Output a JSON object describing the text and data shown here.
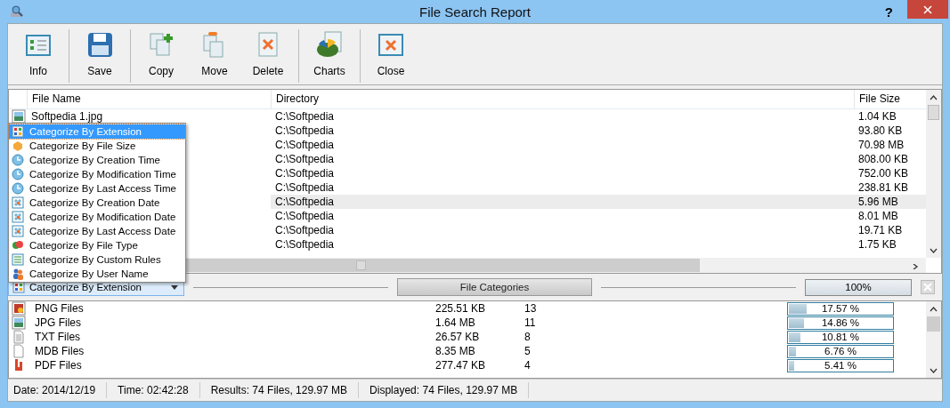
{
  "window": {
    "title": "File Search Report",
    "help": "?"
  },
  "toolbar": [
    {
      "label": "Info",
      "kind": "info"
    },
    {
      "label": "Save",
      "kind": "save"
    },
    {
      "label": "Copy",
      "kind": "copy"
    },
    {
      "label": "Move",
      "kind": "move"
    },
    {
      "label": "Delete",
      "kind": "delete"
    },
    {
      "label": "Charts",
      "kind": "charts"
    },
    {
      "label": "Close",
      "kind": "close"
    }
  ],
  "table": {
    "columns": [
      "File Name",
      "Directory",
      "File Size"
    ],
    "rows": [
      {
        "name": "Softpedia 1.jpg",
        "directory": "C:\\Softpedia",
        "size": "1.04 KB",
        "selected": false
      },
      {
        "directory": "C:\\Softpedia",
        "size": "93.80 KB",
        "selected": false
      },
      {
        "directory": "C:\\Softpedia",
        "size": "70.98 MB",
        "selected": false
      },
      {
        "directory": "C:\\Softpedia",
        "size": "808.00 KB",
        "selected": false
      },
      {
        "directory": "C:\\Softpedia",
        "size": "752.00 KB",
        "selected": false
      },
      {
        "directory": "C:\\Softpedia",
        "size": "238.81 KB",
        "selected": false
      },
      {
        "directory": "C:\\Softpedia",
        "size": "5.96 MB",
        "selected": true
      },
      {
        "directory": "C:\\Softpedia",
        "size": "8.01 MB",
        "selected": false
      },
      {
        "directory": "C:\\Softpedia",
        "size": "19.71 KB",
        "selected": false
      },
      {
        "directory": "C:\\Softpedia",
        "size": "1.75 KB",
        "selected": false
      }
    ]
  },
  "menu": {
    "items": [
      {
        "label": "Categorize By Extension",
        "kind": "grid",
        "selected": true
      },
      {
        "label": "Categorize By File Size",
        "kind": "box",
        "selected": false
      },
      {
        "label": "Categorize By Creation Time",
        "kind": "clock",
        "selected": false
      },
      {
        "label": "Categorize By Modification Time",
        "kind": "clock",
        "selected": false
      },
      {
        "label": "Categorize By Last Access Time",
        "kind": "clock",
        "selected": false
      },
      {
        "label": "Categorize By Creation Date",
        "kind": "calendar",
        "selected": false
      },
      {
        "label": "Categorize By Modification Date",
        "kind": "calendar",
        "selected": false
      },
      {
        "label": "Categorize By Last Access Date",
        "kind": "calendar",
        "selected": false
      },
      {
        "label": "Categorize By File Type",
        "kind": "hearts",
        "selected": false
      },
      {
        "label": "Categorize By Custom Rules",
        "kind": "list",
        "selected": false
      },
      {
        "label": "Categorize By User Name",
        "kind": "users",
        "selected": false
      }
    ]
  },
  "category_select": {
    "value": "Categorize By Extension"
  },
  "file_categories_button": "File Categories",
  "total_progress": {
    "label": "100%",
    "level": 1
  },
  "categories": [
    {
      "name": "PNG Files",
      "kind": "png",
      "size": "225.51 KB",
      "count": "13",
      "percent": "17.57 %",
      "level": 0.1757
    },
    {
      "name": "JPG Files",
      "kind": "jpg",
      "size": "1.64 MB",
      "count": "11",
      "percent": "14.86 %",
      "level": 0.1486
    },
    {
      "name": "TXT Files",
      "kind": "txt",
      "size": "26.57 KB",
      "count": "8",
      "percent": "10.81 %",
      "level": 0.1081
    },
    {
      "name": "MDB Files",
      "kind": "blank",
      "size": "8.35 MB",
      "count": "5",
      "percent": "6.76 %",
      "level": 0.0676
    },
    {
      "name": "PDF Files",
      "kind": "pdf",
      "size": "277.47 KB",
      "count": "4",
      "percent": "5.41 %",
      "level": 0.0541
    }
  ],
  "status_bar": [
    "Date: 2014/12/19",
    "Time: 02:42:28",
    "Results: 74 Files, 129.97 MB",
    "Displayed: 74 Files, 129.97 MB"
  ]
}
